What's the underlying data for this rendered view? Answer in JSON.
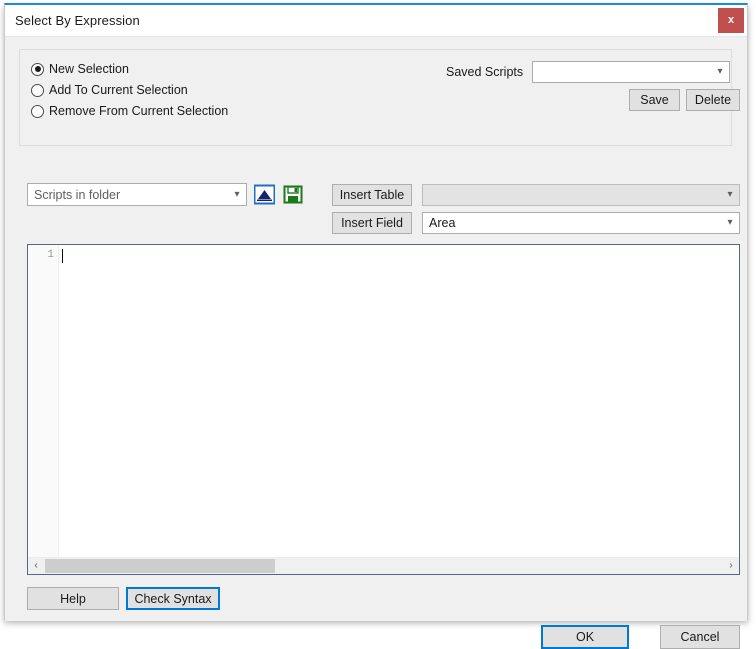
{
  "window": {
    "title": "Select By Expression",
    "close_label": "x",
    "accent_color": "#1e8ad6",
    "close_color": "#c0504d"
  },
  "selection_mode": {
    "options": [
      {
        "label": "New Selection",
        "checked": true
      },
      {
        "label": "Add To Current Selection",
        "checked": false
      },
      {
        "label": "Remove From Current Selection",
        "checked": false
      }
    ]
  },
  "saved_scripts": {
    "label": "Saved Scripts",
    "value": "",
    "save_label": "Save",
    "delete_label": "Delete"
  },
  "toolbar": {
    "scripts_folder_value": "Scripts in folder",
    "open_icon": "open-script-icon",
    "save_icon": "save-script-icon",
    "insert_table_label": "Insert Table",
    "insert_field_label": "Insert Field",
    "table_value": "",
    "field_value": "Area"
  },
  "editor": {
    "line_number": "1",
    "content": ""
  },
  "scrollbar": {
    "left_arrow": "‹",
    "right_arrow": "›"
  },
  "footer": {
    "help_label": "Help",
    "check_syntax_label": "Check Syntax",
    "ok_label": "OK",
    "cancel_label": "Cancel"
  }
}
